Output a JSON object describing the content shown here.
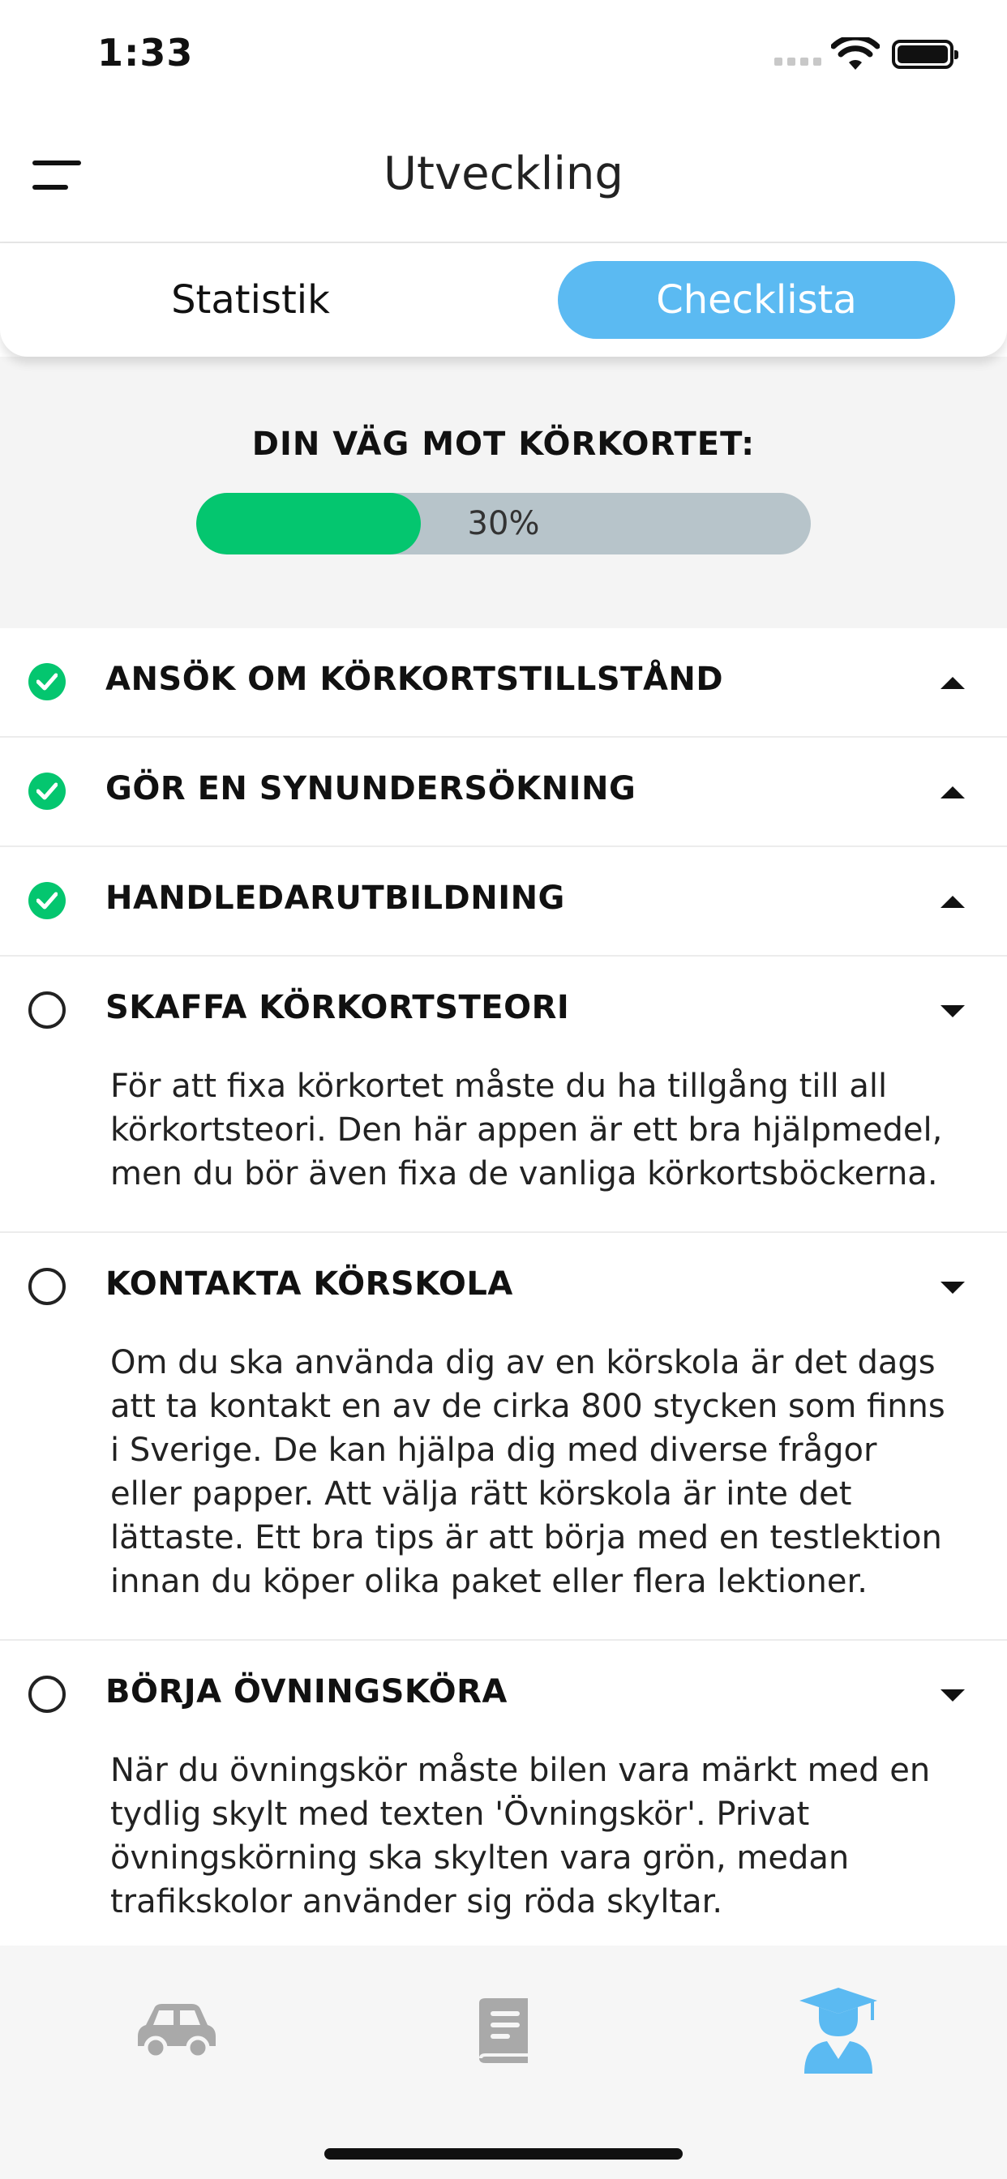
{
  "status_bar": {
    "time": "1:33"
  },
  "header": {
    "title": "Utveckling",
    "menu_icon": "hamburger-menu-icon"
  },
  "tabs": [
    {
      "label": "Statistik",
      "active": false
    },
    {
      "label": "Checklista",
      "active": true
    }
  ],
  "progress": {
    "title": "DIN VÄG MOT KÖRKORTET:",
    "percent": 30,
    "label": "30%"
  },
  "checklist": [
    {
      "title": "ANSÖK OM KÖRKORTSTILLSTÅND",
      "done": true,
      "expanded": false
    },
    {
      "title": "GÖR EN SYNUNDERSÖKNING",
      "done": true,
      "expanded": false
    },
    {
      "title": "HANDLEDARUTBILDNING",
      "done": true,
      "expanded": false
    },
    {
      "title": "SKAFFA KÖRKORTSTEORI",
      "done": false,
      "expanded": true,
      "description": "För att fixa körkortet måste du ha tillgång till all körkortsteori. Den här appen är ett bra hjälpmedel, men du bör även fixa de vanliga körkortsböckerna."
    },
    {
      "title": "KONTAKTA KÖRSKOLA",
      "done": false,
      "expanded": true,
      "description": "Om du ska använda dig av en körskola är det dags att ta kontakt en av de cirka 800 stycken som finns i Sverige. De kan hjälpa dig med diverse frågor eller papper. Att välja rätt körskola är inte det lättaste. Ett bra tips är att börja med en testlektion innan du köper olika paket eller flera lektioner."
    },
    {
      "title": "BÖRJA ÖVNINGSKÖRA",
      "done": false,
      "expanded": true,
      "description": "När du övningskör måste bilen vara märkt med en tydlig skylt med texten 'Övningskör'. Privat övningskörning ska skylten vara grön, medan trafikskolor använder sig röda skyltar."
    }
  ],
  "bottom_nav": [
    {
      "icon": "car-icon",
      "active": false
    },
    {
      "icon": "book-icon",
      "active": false
    },
    {
      "icon": "student-icon",
      "active": true
    }
  ],
  "colors": {
    "accent": "#5bbaf2",
    "success": "#04c66f",
    "track": "#b7c4ca",
    "inactive_icon": "#a9a9a9"
  }
}
